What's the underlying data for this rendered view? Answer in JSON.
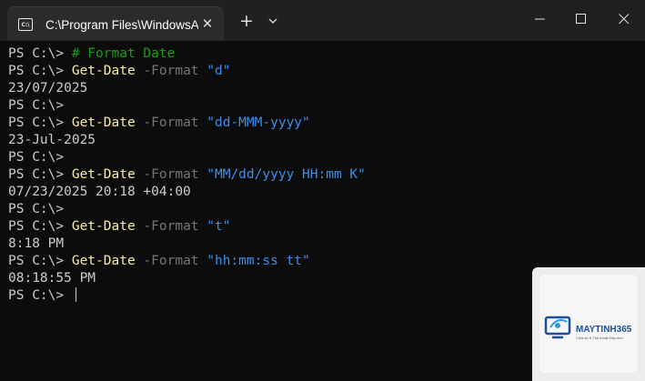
{
  "window": {
    "tab_title": "C:\\Program Files\\WindowsAp",
    "tab_icon": "terminal-icon",
    "tab_icon_text": "C:\\",
    "close_tab_glyph": "✕",
    "new_tab_glyph": "+",
    "minimize_glyph": "—",
    "maximize_glyph": "☐",
    "close_glyph": "✕"
  },
  "terminal": {
    "lines": [
      {
        "prompt": "PS C:\\> ",
        "comment": "# Format Date"
      },
      {
        "prompt": "PS C:\\> ",
        "cmd": "Get-Date",
        "param": " -Format ",
        "arg": "\"d\""
      },
      {
        "output": "23/07/2025"
      },
      {
        "prompt": "PS C:\\> "
      },
      {
        "prompt": "PS C:\\> ",
        "cmd": "Get-Date",
        "param": " -Format ",
        "arg": "\"dd-MMM-yyyy\""
      },
      {
        "output": "23-Jul-2025"
      },
      {
        "prompt": "PS C:\\> "
      },
      {
        "prompt": "PS C:\\> ",
        "cmd": "Get-Date",
        "param": " -Format ",
        "arg": "\"MM/dd/yyyy HH:mm K\""
      },
      {
        "output": "07/23/2025 20:18 +04:00"
      },
      {
        "prompt": "PS C:\\> "
      },
      {
        "prompt": "PS C:\\> ",
        "cmd": "Get-Date",
        "param": " -Format ",
        "arg": "\"t\""
      },
      {
        "output": "8:18 PM"
      },
      {
        "prompt": "PS C:\\> ",
        "cmd": "Get-Date",
        "param": " -Format ",
        "arg": "\"hh:mm:ss tt\""
      },
      {
        "output": "08:18:55 PM"
      },
      {
        "prompt": "PS C:\\> ",
        "cursor": true
      }
    ]
  },
  "watermark": {
    "brand": "MAYTINH365",
    "tagline": "Chia sẻ & Thủ thuật Máy tính"
  },
  "colors": {
    "background": "#0c0c0c",
    "titlebar": "#202020",
    "tab": "#2b2b2b",
    "command": "#f9f1a5",
    "parameter": "#767676",
    "string": "#3b8eea",
    "comment": "#13a10e",
    "text": "#cccccc"
  }
}
